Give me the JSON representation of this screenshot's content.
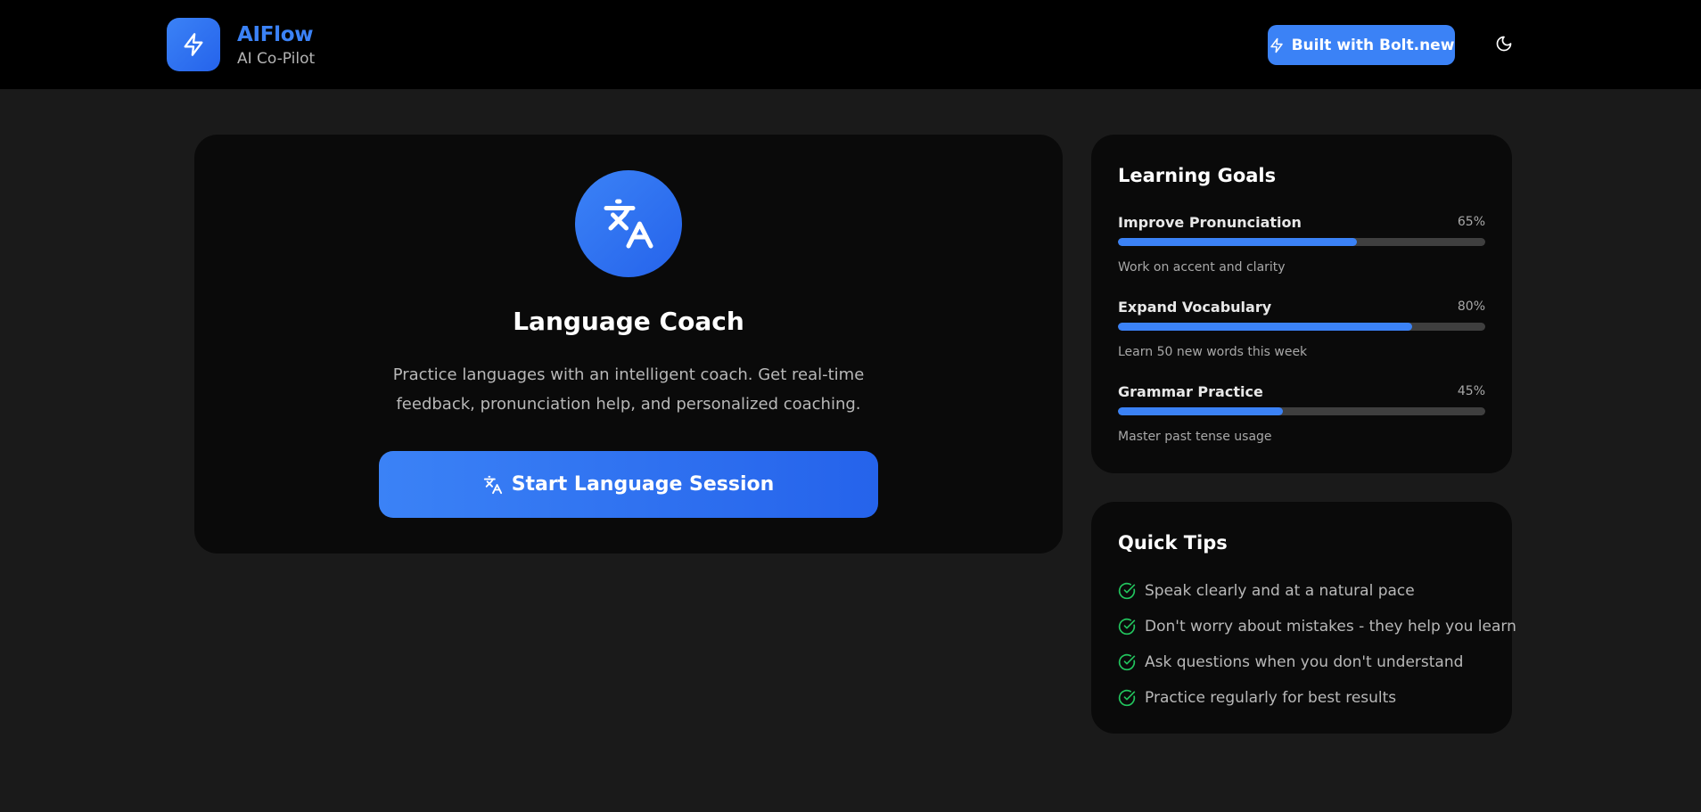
{
  "header": {
    "brand_name": "AIFlow",
    "brand_sub": "AI Co-Pilot",
    "bolt_button_label": "Built with Bolt.new",
    "logo_icon": "lightning-icon",
    "theme_icon": "moon-icon"
  },
  "coach": {
    "icon": "translate-icon",
    "title": "Language Coach",
    "description": "Practice languages with an intelligent coach. Get real-time feedback, pronunciation help, and personalized coaching.",
    "start_button_label": "Start Language Session"
  },
  "goals": {
    "title": "Learning Goals",
    "items": [
      {
        "title": "Improve Pronunciation",
        "percent_label": "65%",
        "progress": 0.65,
        "description": "Work on accent and clarity"
      },
      {
        "title": "Expand Vocabulary",
        "percent_label": "80%",
        "progress": 0.8,
        "description": "Learn 50 new words this week"
      },
      {
        "title": "Grammar Practice",
        "percent_label": "45%",
        "progress": 0.45,
        "description": "Master past tense usage"
      }
    ]
  },
  "tips": {
    "title": "Quick Tips",
    "icon": "check-circle-icon",
    "items": [
      "Speak clearly and at a natural pace",
      "Don't worry about mistakes - they help you learn",
      "Ask questions when you don't understand",
      "Practice regularly for best results"
    ]
  },
  "colors": {
    "accent": "#3b82f6",
    "success": "#22c55e",
    "background": "#1a1a1a",
    "card": "#0a0a0a"
  }
}
